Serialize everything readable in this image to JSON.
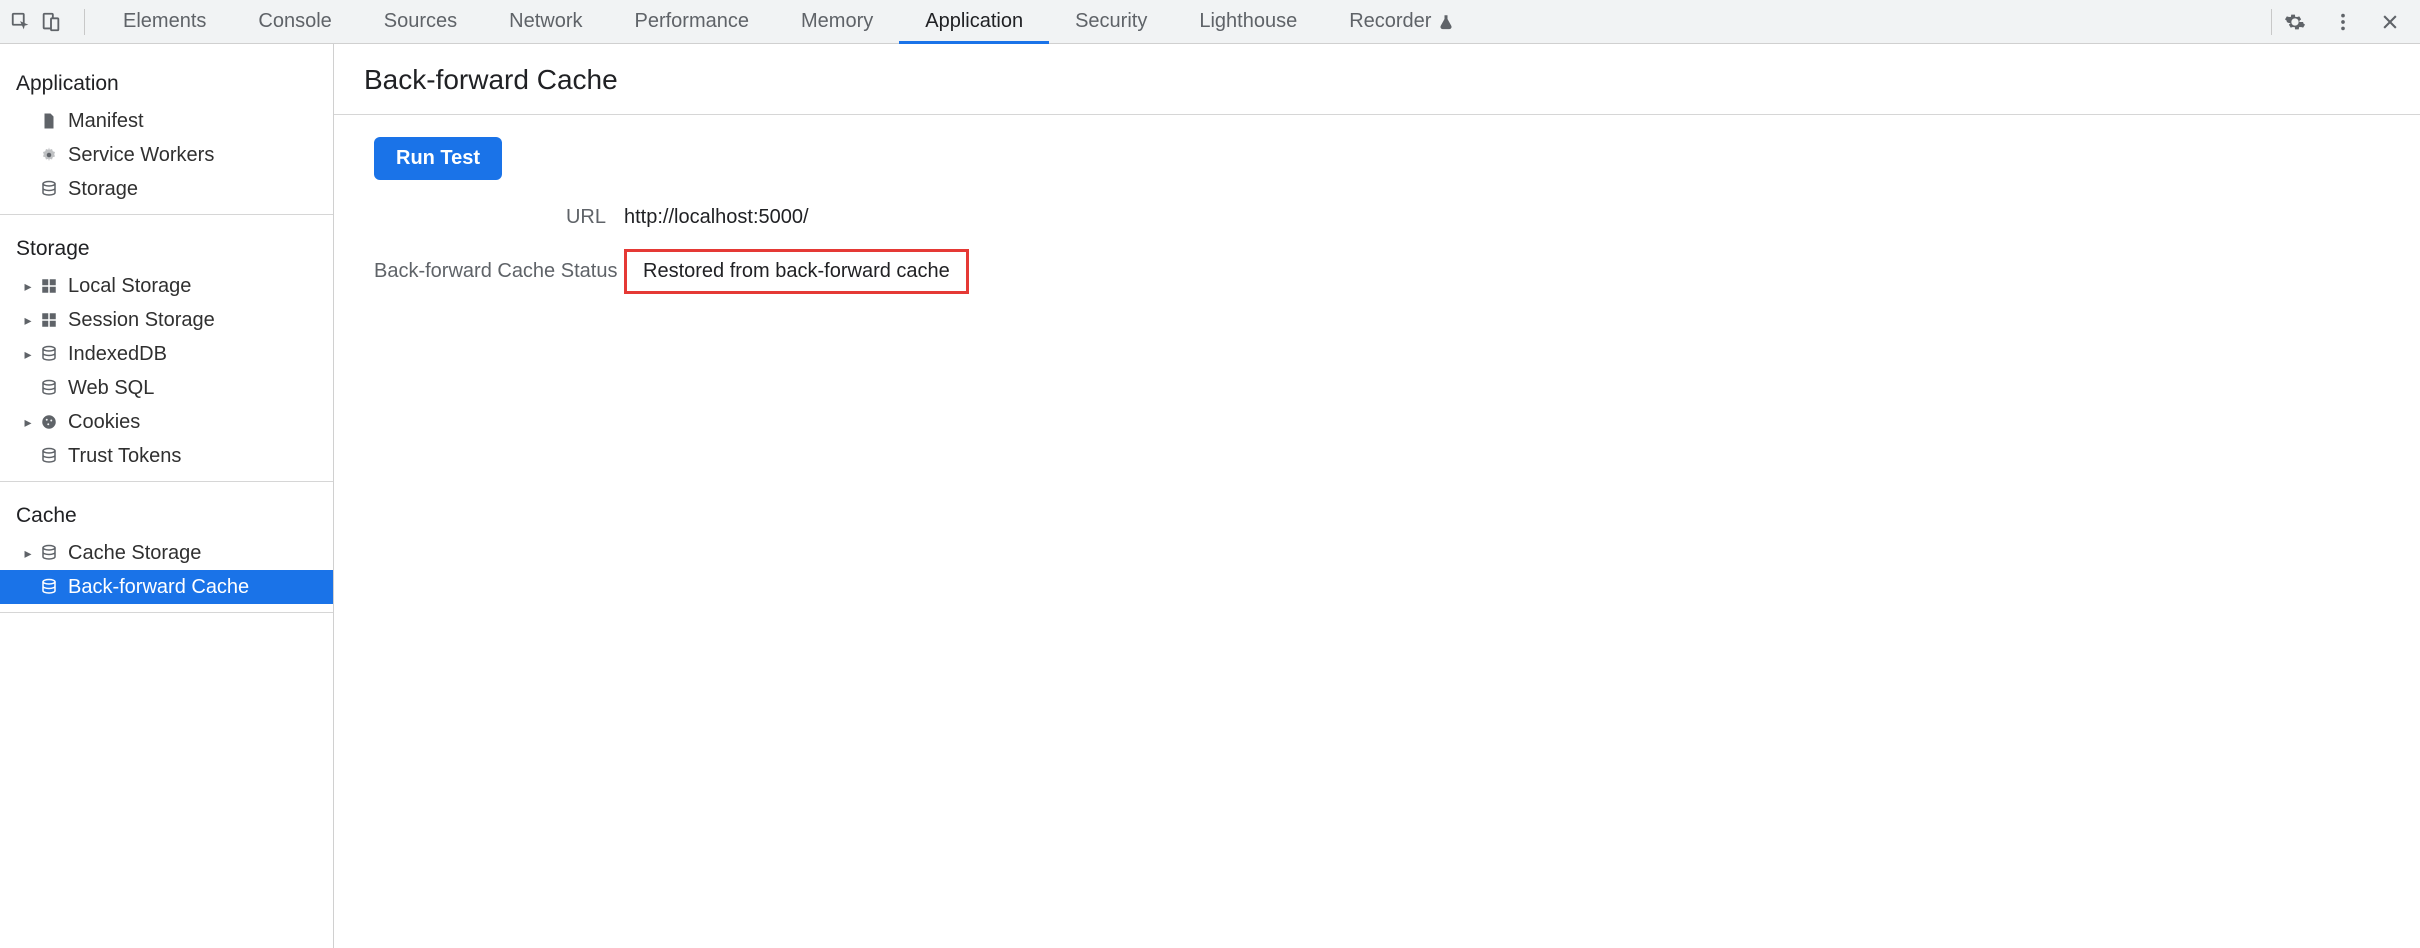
{
  "tabs": {
    "items": [
      {
        "label": "Elements"
      },
      {
        "label": "Console"
      },
      {
        "label": "Sources"
      },
      {
        "label": "Network"
      },
      {
        "label": "Performance"
      },
      {
        "label": "Memory"
      },
      {
        "label": "Application"
      },
      {
        "label": "Security"
      },
      {
        "label": "Lighthouse"
      },
      {
        "label": "Recorder"
      }
    ]
  },
  "sidebar": {
    "groups": [
      {
        "label": "Application",
        "items": [
          {
            "label": "Manifest",
            "icon": "file",
            "expandable": false
          },
          {
            "label": "Service Workers",
            "icon": "gear",
            "expandable": false
          },
          {
            "label": "Storage",
            "icon": "db",
            "expandable": false
          }
        ]
      },
      {
        "label": "Storage",
        "items": [
          {
            "label": "Local Storage",
            "icon": "grid",
            "expandable": true
          },
          {
            "label": "Session Storage",
            "icon": "grid",
            "expandable": true
          },
          {
            "label": "IndexedDB",
            "icon": "db",
            "expandable": true
          },
          {
            "label": "Web SQL",
            "icon": "db",
            "expandable": false
          },
          {
            "label": "Cookies",
            "icon": "cookie",
            "expandable": true
          },
          {
            "label": "Trust Tokens",
            "icon": "db",
            "expandable": false
          }
        ]
      },
      {
        "label": "Cache",
        "items": [
          {
            "label": "Cache Storage",
            "icon": "db",
            "expandable": true
          },
          {
            "label": "Back-forward Cache",
            "icon": "db",
            "expandable": false,
            "selected": true
          }
        ]
      }
    ]
  },
  "main": {
    "title": "Back-forward Cache",
    "run_button": "Run Test",
    "rows": [
      {
        "label": "URL",
        "value": "http://localhost:5000/",
        "highlight": false
      },
      {
        "label": "Back-forward Cache Status",
        "value": "Restored from back-forward cache",
        "highlight": true
      }
    ]
  }
}
